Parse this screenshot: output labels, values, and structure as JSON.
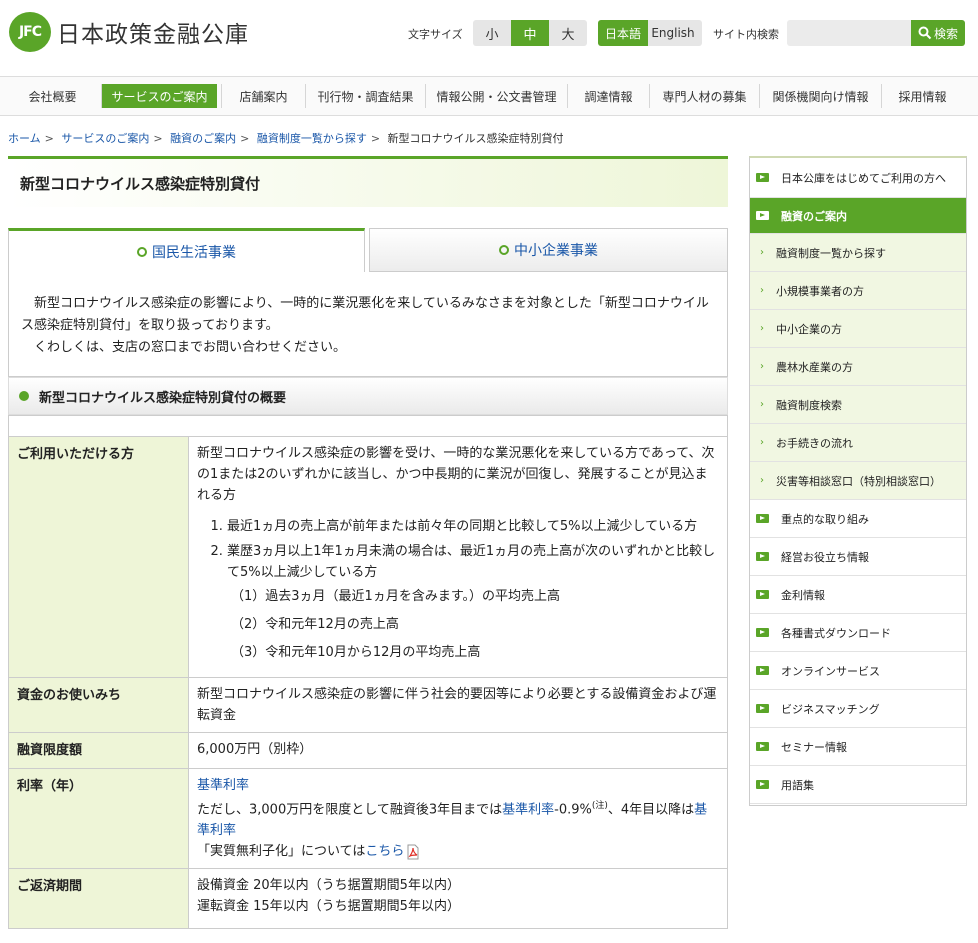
{
  "header": {
    "logo_mark": "JFC",
    "logo_text": "日本政策金融公庫",
    "font_size_label": "文字サイズ",
    "font_sizes": [
      "小",
      "中",
      "大"
    ],
    "font_size_selected": "中",
    "languages": [
      "日本語",
      "English"
    ],
    "language_selected": "日本語",
    "search_label": "サイト内検索",
    "search_placeholder": "",
    "search_button": "検索"
  },
  "gnav": [
    "会社概要",
    "サービスのご案内",
    "店舗案内",
    "刊行物・調査結果",
    "情報公開・公文書管理",
    "調達情報",
    "専門人材の募集",
    "関係機関向け情報",
    "採用情報"
  ],
  "gnav_active": "サービスのご案内",
  "breadcrumb": [
    "ホーム",
    "サービスのご案内",
    "融資のご案内",
    "融資制度一覧から探す",
    "新型コロナウイルス感染症特別貸付"
  ],
  "breadcrumb_sep": ">",
  "page_title": "新型コロナウイルス感染症特別貸付",
  "tabs": [
    "国民生活事業",
    "中小企業事業"
  ],
  "intro": {
    "p1": "新型コロナウイルス感染症の影響により、一時的に業況悪化を来しているみなさまを対象とした「新型コロナウイルス感染症特別貸付」を取り扱っております。",
    "p2": "くわしくは、支店の窓口までお問い合わせください。"
  },
  "section_heading": "新型コロナウイルス感染症特別貸付の概要",
  "table": {
    "row1": {
      "label": "ご利用いただける方",
      "text": "新型コロナウイルス感染症の影響を受け、一時的な業況悪化を来している方であって、次の1または2のいずれかに該当し、かつ中長期的に業況が回復し、発展することが見込まれる方",
      "item1": "最近1ヵ月の売上高が前年または前々年の同期と比較して5%以上減少している方",
      "item2": "業歴3ヵ月以上1年1ヵ月未満の場合は、最近1ヵ月の売上高が次のいずれかと比較して5%以上減少している方",
      "sub1": "（1）過去3ヵ月（最近1ヵ月を含みます。）の平均売上高",
      "sub2": "（2）令和元年12月の売上高",
      "sub3": "（3）令和元年10月から12月の平均売上高"
    },
    "row2": {
      "label": "資金のお使いみち",
      "text": "新型コロナウイルス感染症の影響に伴う社会的要因等により必要とする設備資金および運転資金"
    },
    "row3": {
      "label": "融資限度額",
      "text": "6,000万円（別枠）"
    },
    "row4": {
      "label": "利率（年）",
      "link1": "基準利率",
      "t1": "ただし、3,000万円を限度として融資後3年目までは",
      "link2": "基準利率",
      "t2": "-0.9%",
      "note": "(注)",
      "t3": "、4年目以降は",
      "link3": "基準利率",
      "t4": "「実質無利子化」については",
      "link4": "こちら"
    },
    "row5": {
      "label": "ご返済期間",
      "line1": "設備資金 20年以内（うち据置期間5年以内）",
      "line2": "運転資金 15年以内（うち据置期間5年以内）"
    }
  },
  "side_nav": [
    {
      "label": "日本公庫をはじめてご利用の方へ",
      "kind": "top"
    },
    {
      "label": "融資のご案内",
      "kind": "active"
    },
    {
      "label": "融資制度一覧から探す",
      "kind": "child"
    },
    {
      "label": "小規模事業者の方",
      "kind": "child"
    },
    {
      "label": "中小企業の方",
      "kind": "child"
    },
    {
      "label": "農林水産業の方",
      "kind": "child"
    },
    {
      "label": "融資制度検索",
      "kind": "child"
    },
    {
      "label": "お手続きの流れ",
      "kind": "child"
    },
    {
      "label": "災害等相談窓口（特別相談窓口）",
      "kind": "child"
    },
    {
      "label": "重点的な取り組み",
      "kind": "top"
    },
    {
      "label": "経営お役立ち情報",
      "kind": "top"
    },
    {
      "label": "金利情報",
      "kind": "top"
    },
    {
      "label": "各種書式ダウンロード",
      "kind": "top"
    },
    {
      "label": "オンラインサービス",
      "kind": "top"
    },
    {
      "label": "ビジネスマッチング",
      "kind": "top"
    },
    {
      "label": "セミナー情報",
      "kind": "top"
    },
    {
      "label": "用語集",
      "kind": "top"
    }
  ],
  "colors": {
    "brand_green": "#5aa528",
    "link_blue": "#1a57a8",
    "table_head_bg": "#eef5d7"
  }
}
